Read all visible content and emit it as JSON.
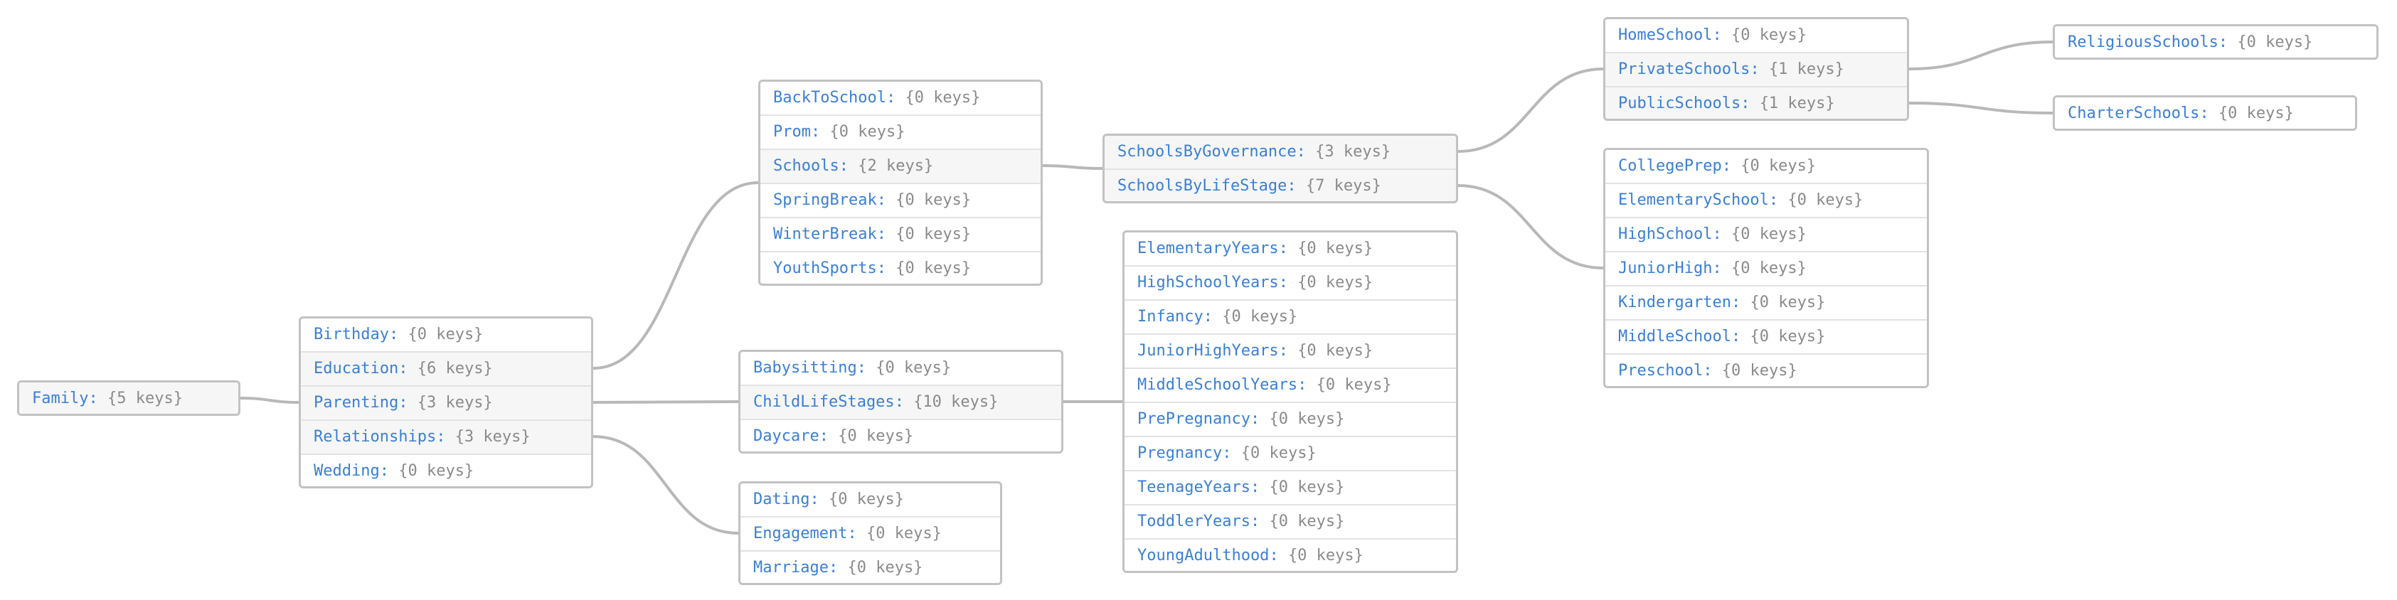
{
  "colors": {
    "key": "#3a7fd5",
    "value": "#8a8a8a",
    "border": "#c2c2c2",
    "edge": "#b8b8b8",
    "parent_row_bg": "#f6f6f6"
  },
  "nodes": [
    {
      "id": "root",
      "rows": [
        {
          "key": "Family",
          "value": "{5 keys}",
          "child": "family"
        }
      ]
    },
    {
      "id": "family",
      "rows": [
        {
          "key": "Birthday",
          "value": "{0 keys}"
        },
        {
          "key": "Education",
          "value": "{6 keys}",
          "child": "education"
        },
        {
          "key": "Parenting",
          "value": "{3 keys}",
          "child": "parenting"
        },
        {
          "key": "Relationships",
          "value": "{3 keys}",
          "child": "relationships"
        },
        {
          "key": "Wedding",
          "value": "{0 keys}"
        }
      ]
    },
    {
      "id": "education",
      "rows": [
        {
          "key": "BackToSchool",
          "value": "{0 keys}"
        },
        {
          "key": "Prom",
          "value": "{0 keys}"
        },
        {
          "key": "Schools",
          "value": "{2 keys}",
          "child": "schools"
        },
        {
          "key": "SpringBreak",
          "value": "{0 keys}"
        },
        {
          "key": "WinterBreak",
          "value": "{0 keys}"
        },
        {
          "key": "YouthSports",
          "value": "{0 keys}"
        }
      ]
    },
    {
      "id": "parenting",
      "rows": [
        {
          "key": "Babysitting",
          "value": "{0 keys}"
        },
        {
          "key": "ChildLifeStages",
          "value": "{10 keys}",
          "child": "childlifestages"
        },
        {
          "key": "Daycare",
          "value": "{0 keys}"
        }
      ]
    },
    {
      "id": "relationships",
      "rows": [
        {
          "key": "Dating",
          "value": "{0 keys}"
        },
        {
          "key": "Engagement",
          "value": "{0 keys}"
        },
        {
          "key": "Marriage",
          "value": "{0 keys}"
        }
      ]
    },
    {
      "id": "schools",
      "rows": [
        {
          "key": "SchoolsByGovernance",
          "value": "{3 keys}",
          "child": "governance"
        },
        {
          "key": "SchoolsByLifeStage",
          "value": "{7 keys}",
          "child": "lifestage"
        }
      ]
    },
    {
      "id": "childlifestages",
      "rows": [
        {
          "key": "ElementaryYears",
          "value": "{0 keys}"
        },
        {
          "key": "HighSchoolYears",
          "value": "{0 keys}"
        },
        {
          "key": "Infancy",
          "value": "{0 keys}"
        },
        {
          "key": "JuniorHighYears",
          "value": "{0 keys}"
        },
        {
          "key": "MiddleSchoolYears",
          "value": "{0 keys}"
        },
        {
          "key": "PrePregnancy",
          "value": "{0 keys}"
        },
        {
          "key": "Pregnancy",
          "value": "{0 keys}"
        },
        {
          "key": "TeenageYears",
          "value": "{0 keys}"
        },
        {
          "key": "ToddlerYears",
          "value": "{0 keys}"
        },
        {
          "key": "YoungAdulthood",
          "value": "{0 keys}"
        }
      ]
    },
    {
      "id": "governance",
      "rows": [
        {
          "key": "HomeSchool",
          "value": "{0 keys}"
        },
        {
          "key": "PrivateSchools",
          "value": "{1 keys}",
          "child": "private"
        },
        {
          "key": "PublicSchools",
          "value": "{1 keys}",
          "child": "public"
        }
      ]
    },
    {
      "id": "lifestage",
      "rows": [
        {
          "key": "CollegePrep",
          "value": "{0 keys}"
        },
        {
          "key": "ElementarySchool",
          "value": "{0 keys}"
        },
        {
          "key": "HighSchool",
          "value": "{0 keys}"
        },
        {
          "key": "JuniorHigh",
          "value": "{0 keys}"
        },
        {
          "key": "Kindergarten",
          "value": "{0 keys}"
        },
        {
          "key": "MiddleSchool",
          "value": "{0 keys}"
        },
        {
          "key": "Preschool",
          "value": "{0 keys}"
        }
      ]
    },
    {
      "id": "private",
      "rows": [
        {
          "key": "ReligiousSchools",
          "value": "{0 keys}"
        }
      ]
    },
    {
      "id": "public",
      "rows": [
        {
          "key": "CharterSchools",
          "value": "{0 keys}"
        }
      ]
    }
  ]
}
